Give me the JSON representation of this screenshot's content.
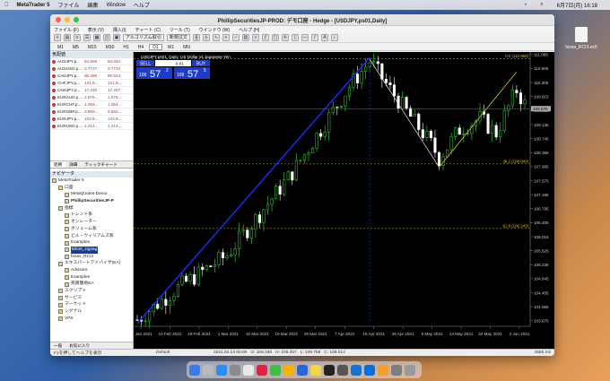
{
  "mac_menubar": {
    "app": "MetaTrader 5",
    "items": [
      "ファイル",
      "編集",
      "Window",
      "ヘルプ"
    ],
    "clock": "6月7日(月)  16:18"
  },
  "desktop_file": "fxnav_RCI3.ex5",
  "window": {
    "title": "PhillipSecuritiesJP-PROD: デモ口座 - Hedge - [USDJPY,ps01,Daily]",
    "menu": [
      "ファイル (F)",
      "表示 (V)",
      "挿入(I)",
      "チャート (C)",
      "ツール (T)",
      "ウインドウ (W)",
      "ヘルプ (H)"
    ],
    "toolbar": {
      "algo": "アルゴリズム取引",
      "new_order": "新規注文"
    },
    "timeframes": [
      "M1",
      "M5",
      "M15",
      "M30",
      "H1",
      "H4",
      "D1",
      "W1",
      "MN"
    ],
    "active_tf": "D1"
  },
  "market_watch": {
    "header": "気配値",
    "rows": [
      {
        "sym": "AUDJPY.p...",
        "bid": "84.669",
        "ask": "84.694"
      },
      {
        "sym": "AUDUSD.p...",
        "bid": "0.7727",
        "ask": "0.7734"
      },
      {
        "sym": "CADJPY.p...",
        "bid": "90.498",
        "ask": "90.524"
      },
      {
        "sym": "CHFJPY.p...",
        "bid": "121.8...",
        "ask": "121.8..."
      },
      {
        "sym": "CNHJPY.p...",
        "bid": "17.232",
        "ask": "17.257"
      },
      {
        "sym": "EURAUD.p...",
        "bid": "1.575...",
        "ask": "1.575..."
      },
      {
        "sym": "EURCHF.p...",
        "bid": "1.093...",
        "ask": "1.094..."
      },
      {
        "sym": "EURGBP.p...",
        "bid": "0.859...",
        "ask": "0.860..."
      },
      {
        "sym": "EURJPY.p...",
        "bid": "133.8...",
        "ask": "133.8..."
      },
      {
        "sym": "EURUSD.p...",
        "bid": "1.214...",
        "ask": "1.214..."
      }
    ],
    "tabs": [
      "銘柄",
      "詳細",
      "ティックチャート"
    ]
  },
  "navigator": {
    "header": "ナビゲータ",
    "items": [
      {
        "label": "MetaTrader 5",
        "indent": 0,
        "bold": false,
        "sel": false
      },
      {
        "label": "口座",
        "indent": 1,
        "bold": false,
        "sel": false
      },
      {
        "label": "MetaQuotes-Demo",
        "indent": 2,
        "bold": false,
        "sel": false
      },
      {
        "label": "PhillipSecuritiesJP-P",
        "indent": 2,
        "bold": true,
        "sel": false
      },
      {
        "label": "指標",
        "indent": 1,
        "bold": false,
        "sel": false
      },
      {
        "label": "トレンド系",
        "indent": 2,
        "bold": false,
        "sel": false
      },
      {
        "label": "オシレーター",
        "indent": 2,
        "bold": false,
        "sel": false
      },
      {
        "label": "ボリューム系",
        "indent": 2,
        "bold": false,
        "sel": false
      },
      {
        "label": "ビル・ウィリアムズ系",
        "indent": 2,
        "bold": false,
        "sel": false
      },
      {
        "label": "Examples",
        "indent": 2,
        "bold": false,
        "sel": false
      },
      {
        "label": "Elliott_zigzag",
        "indent": 2,
        "bold": false,
        "sel": true
      },
      {
        "label": "fxnav_RCI3",
        "indent": 2,
        "bold": false,
        "sel": false
      },
      {
        "label": "エキスパートアドバイザ(EA)",
        "indent": 1,
        "bold": false,
        "sel": false
      },
      {
        "label": "Advisors",
        "indent": 2,
        "bold": false,
        "sel": false
      },
      {
        "label": "Examples",
        "indent": 2,
        "bold": false,
        "sel": false
      },
      {
        "label": "売買簡易EA",
        "indent": 2,
        "bold": false,
        "sel": false
      },
      {
        "label": "スクリプト",
        "indent": 1,
        "bold": false,
        "sel": false
      },
      {
        "label": "サービス",
        "indent": 1,
        "bold": false,
        "sel": false
      },
      {
        "label": "マーケット",
        "indent": 1,
        "bold": false,
        "sel": false
      },
      {
        "label": "シグナル",
        "indent": 1,
        "bold": false,
        "sel": false
      },
      {
        "label": "VPS",
        "indent": 1,
        "bold": false,
        "sel": false
      }
    ],
    "tabs": [
      "一般",
      "お気に入り"
    ]
  },
  "chart_data": {
    "type": "candlestick",
    "symbol_label": "USDJPY.ps01, Daily: US Dollar vs Japanese Yen",
    "sell_label": "SELL",
    "buy_label": "BUY",
    "volume": "0.01",
    "sell_price": {
      "pre": "109",
      "big": "57",
      "sup": "2"
    },
    "buy_price": {
      "pre": "109",
      "big": "57",
      "sup": "5"
    },
    "ylim": [
      103.52,
      111.08
    ],
    "y_ticks": [
      "111.085",
      "110.695",
      "110.305",
      "109.915",
      "109.525",
      "109.135",
      "108.745",
      "108.355",
      "107.965",
      "107.575",
      "107.185",
      "106.795",
      "106.405",
      "106.015",
      "105.625",
      "105.235",
      "104.845",
      "104.455",
      "104.065",
      "103.675"
    ],
    "x_ticks": [
      "22 Jan 2021",
      "10 Feb 2021",
      "19 Feb 2021",
      "1 Mar 2021",
      "10 Mar 2021",
      "19 Mar 2021",
      "29 Mar 2021",
      "7 Apr 2021",
      "16 Apr 2021",
      "26 Apr 2021",
      "5 May 2021",
      "14 May 2021",
      "24 May 2021",
      "2 Jun 2021"
    ],
    "current_price": "109.578",
    "fib_levels": [
      {
        "label": "0.0 (110.968)",
        "value": 110.968
      },
      {
        "label": "38.2 (108.040)",
        "value": 108.04
      },
      {
        "label": "61.8 (106.243)",
        "value": 106.243
      }
    ],
    "colors": {
      "up": "#33dd33",
      "down": "#ffffff",
      "zigzag": "#d8c23a",
      "trend": "#1e2cff"
    }
  },
  "statusbar": {
    "help": "F1を押してヘルプを表示",
    "profile": "Default",
    "datetime": "2021.04.14 00:00",
    "open": "O: 109.195",
    "high": "H: 109.257",
    "low": "L: 108.758",
    "close": "C: 109.014",
    "ping": "1585 ms"
  }
}
